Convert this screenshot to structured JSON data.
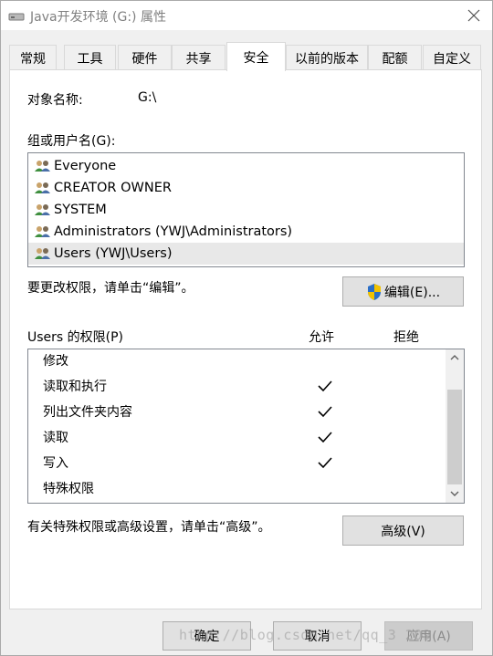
{
  "window": {
    "title": "Java开发环境 (G:) 属性",
    "close_icon": "close-icon",
    "drive_icon": "drive-icon"
  },
  "tabs": [
    {
      "label": "常规",
      "active": false
    },
    {
      "label": "工具",
      "active": false
    },
    {
      "label": "硬件",
      "active": false
    },
    {
      "label": "共享",
      "active": false
    },
    {
      "label": "安全",
      "active": true
    },
    {
      "label": "以前的版本",
      "active": false
    },
    {
      "label": "配额",
      "active": false
    },
    {
      "label": "自定义",
      "active": false
    }
  ],
  "security": {
    "object_name_label": "对象名称:",
    "object_name_value": "G:\\",
    "groups_label": "组或用户名(G):",
    "groups": [
      {
        "name": "Everyone",
        "icon": "users-icon",
        "selected": false
      },
      {
        "name": "CREATOR OWNER",
        "icon": "users-icon",
        "selected": false
      },
      {
        "name": "SYSTEM",
        "icon": "users-icon",
        "selected": false
      },
      {
        "name": "Administrators (YWJ\\Administrators)",
        "icon": "users-icon",
        "selected": false
      },
      {
        "name": "Users (YWJ\\Users)",
        "icon": "users-icon",
        "selected": true
      }
    ],
    "edit_hint": "要更改权限，请单击“编辑”。",
    "edit_button": "编辑(E)...",
    "perm_label": "Users 的权限(P)",
    "allow_header": "允许",
    "deny_header": "拒绝",
    "permissions": [
      {
        "name": "修改",
        "allow": false,
        "deny": false
      },
      {
        "name": "读取和执行",
        "allow": true,
        "deny": false
      },
      {
        "name": "列出文件夹内容",
        "allow": true,
        "deny": false
      },
      {
        "name": "读取",
        "allow": true,
        "deny": false
      },
      {
        "name": "写入",
        "allow": true,
        "deny": false
      },
      {
        "name": "特殊权限",
        "allow": false,
        "deny": false
      }
    ],
    "advanced_hint": "有关特殊权限或高级设置，请单击“高级”。",
    "advanced_button": "高级(V)"
  },
  "footer": {
    "ok": "确定",
    "cancel": "取消",
    "apply": "应用(A)",
    "watermark": "http://blog.csdn.net/qq_3 209"
  },
  "colors": {
    "selection": "#e8e8e8",
    "button_face": "#e1e1e1",
    "button_border": "#adadad",
    "shield_blue": "#2b6fc7",
    "shield_yellow": "#f2c200"
  }
}
